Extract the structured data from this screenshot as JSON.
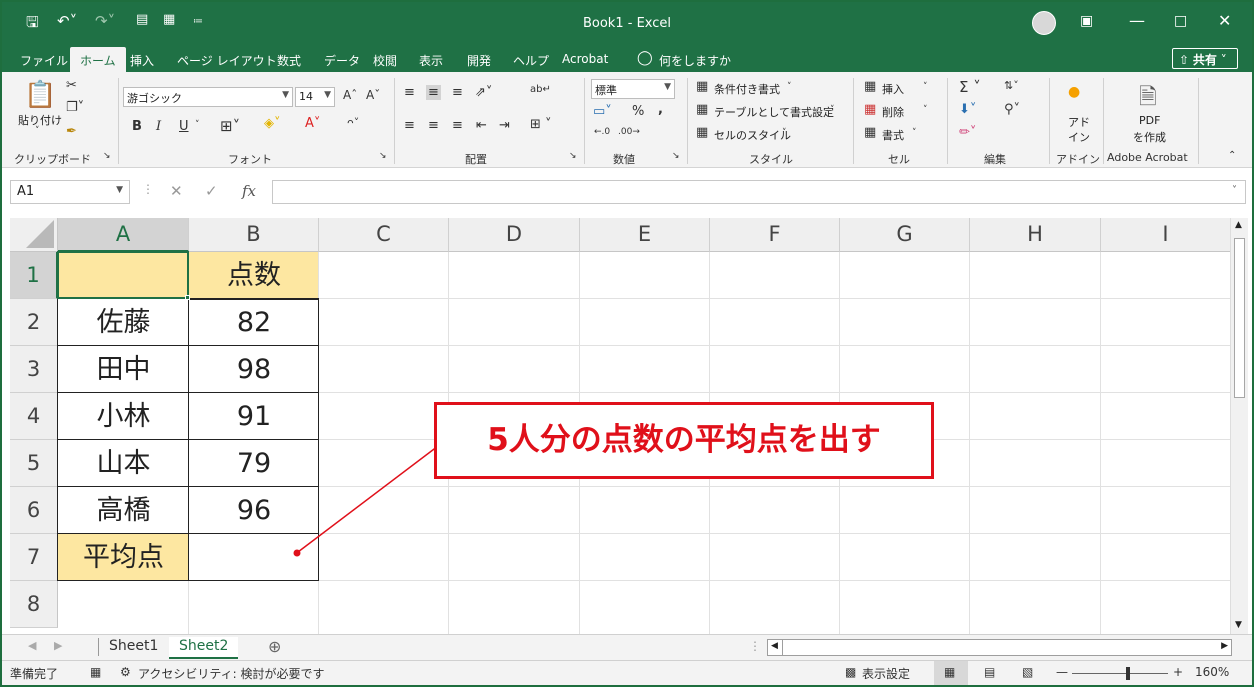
{
  "app": {
    "title": "Book1  -  Excel",
    "accent_color": "#1f7145",
    "quick_access": [
      "save-icon",
      "undo-icon",
      "redo-icon",
      "new-doc-icon",
      "form-icon",
      "customize-icon"
    ]
  },
  "tabs": [
    "ファイル",
    "ホーム",
    "挿入",
    "ページ レイアウト",
    "数式",
    "データ",
    "校閲",
    "表示",
    "開発",
    "ヘルプ",
    "Acrobat",
    "何をしますか"
  ],
  "share_label": "共有",
  "ribbon": {
    "clipboard": {
      "paste": "貼り付け",
      "label": "クリップボード"
    },
    "font": {
      "name": "游ゴシック",
      "size": "14",
      "bold": "B",
      "italic": "I",
      "underline": "U",
      "label": "フォント"
    },
    "alignment": {
      "label": "配置"
    },
    "number": {
      "format": "標準",
      "percent": "%",
      "comma": ",",
      "label": "数値"
    },
    "styles": {
      "conditional": "条件付き書式",
      "table": "テーブルとして書式設定",
      "cell": "セルのスタイル",
      "label": "スタイル"
    },
    "cells": {
      "insert": "挿入",
      "delete": "削除",
      "format": "書式",
      "label": "セル"
    },
    "editing": {
      "label": "編集"
    },
    "addin": {
      "btn1": "アド",
      "btn2": "イン",
      "label": "アドイン"
    },
    "acrobat": {
      "btn1": "PDF",
      "btn2": "を作成",
      "label": "Adobe Acrobat"
    }
  },
  "formula_bar": {
    "cell_ref": "A1",
    "fx": "fx",
    "content": ""
  },
  "columns": [
    "A",
    "B",
    "C",
    "D",
    "E",
    "F",
    "G",
    "H",
    "I"
  ],
  "rows": [
    "1",
    "2",
    "3",
    "4",
    "5",
    "6",
    "7",
    "8"
  ],
  "table": {
    "header": "点数",
    "names": [
      "佐藤",
      "田中",
      "小林",
      "山本",
      "高橋"
    ],
    "scores": [
      "82",
      "98",
      "91",
      "79",
      "96"
    ],
    "avg_label": "平均点",
    "avg_value": ""
  },
  "annotation": {
    "text": "5人分の点数の平均点を出す",
    "color": "#e0101a"
  },
  "sheets": [
    "Sheet1",
    "Sheet2"
  ],
  "active_sheet": "Sheet2",
  "status": {
    "ready": "準備完了",
    "accessibility": "アクセシビリティ: 検討が必要です",
    "display_settings": "表示設定",
    "zoom": "160%"
  }
}
